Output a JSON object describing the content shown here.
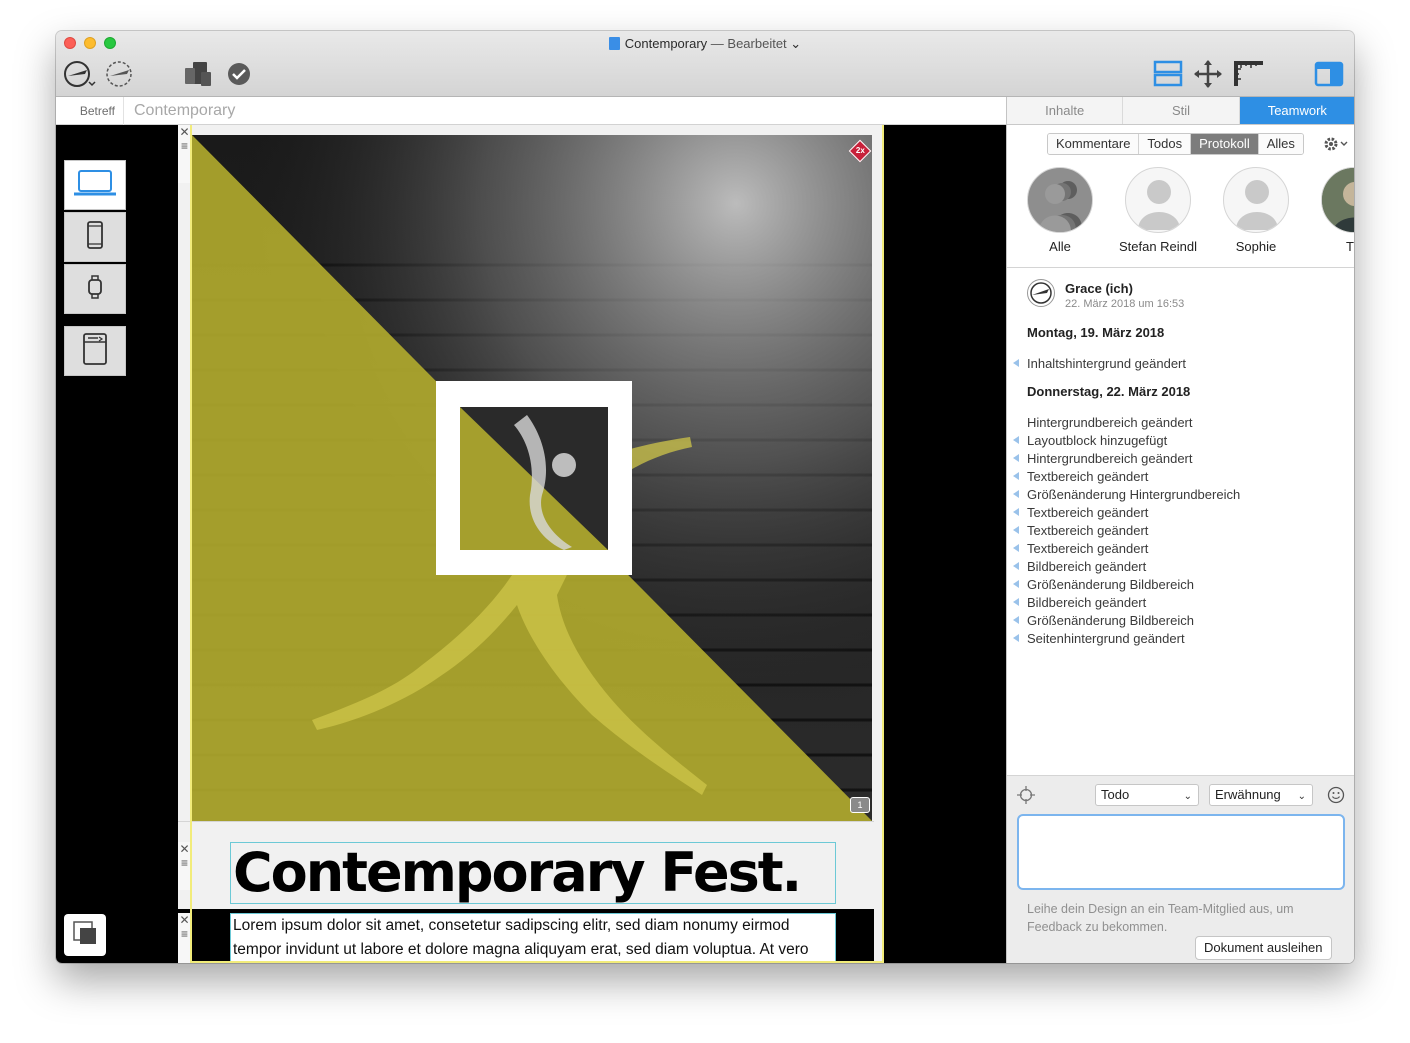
{
  "window": {
    "title": "Contemporary",
    "status": "— Bearbeitet"
  },
  "toolbar": {
    "left_icons": [
      "send-icon",
      "receive-icon",
      "devices-icon",
      "checkmark-icon"
    ],
    "right_icons": [
      "layout-icon",
      "move-icon",
      "ruler-icon",
      "sidebar-icon"
    ]
  },
  "subject": {
    "label": "Betreff",
    "value": "Contemporary"
  },
  "devices": [
    "laptop-icon",
    "phone-icon",
    "watch-icon",
    "newsletter-icon"
  ],
  "canvas": {
    "badge_2x": "2x",
    "comment_count": "1",
    "headline": "Contemporary Fest.",
    "body_text": "Lorem ipsum dolor sit amet, consetetur sadipscing elitr, sed diam nonumy eirmod tempor invidunt ut labore et dolore magna aliquyam erat, sed diam voluptua. At vero"
  },
  "panel": {
    "tabs": [
      {
        "label": "Inhalte",
        "active": false
      },
      {
        "label": "Stil",
        "active": false
      },
      {
        "label": "Teamwork",
        "active": true
      }
    ],
    "filters": [
      {
        "label": "Kommentare",
        "active": false
      },
      {
        "label": "Todos",
        "active": false
      },
      {
        "label": "Protokoll",
        "active": true
      },
      {
        "label": "Alles",
        "active": false
      }
    ],
    "members": [
      {
        "name": "Alle"
      },
      {
        "name": "Stefan Reindl"
      },
      {
        "name": "Sophie"
      },
      {
        "name": "Till"
      }
    ],
    "log_user": {
      "name": "Grace (ich)",
      "time": "22. März 2018 um 16:53"
    },
    "days": [
      {
        "title": "Montag, 19. März 2018",
        "entries": [
          "Inhaltshintergrund geändert"
        ]
      },
      {
        "title": "Donnerstag, 22. März 2018",
        "entries": [
          "Hintergrundbereich geändert",
          "Layoutblock hinzugefügt",
          "Hintergrundbereich geändert",
          "Textbereich geändert",
          "Größenänderung Hintergrundbereich",
          "Textbereich geändert",
          "Textbereich geändert",
          "Textbereich geändert",
          "Bildbereich geändert",
          "Größenänderung Bildbereich",
          "Bildbereich geändert",
          "Größenänderung Bildbereich",
          "Seitenhintergrund geändert"
        ]
      }
    ],
    "composer": {
      "type_select": "Todo",
      "mention_select": "Erwähnung",
      "hint": "Leihe dein Design an ein Team-Mitglied aus, um Feedback zu bekommen.",
      "lend_button": "Dokument ausleihen"
    }
  },
  "colors": {
    "accent": "#2e8fe4",
    "highlight_yellow": "#b8b02e",
    "selection_border": "#6cc9d6"
  }
}
